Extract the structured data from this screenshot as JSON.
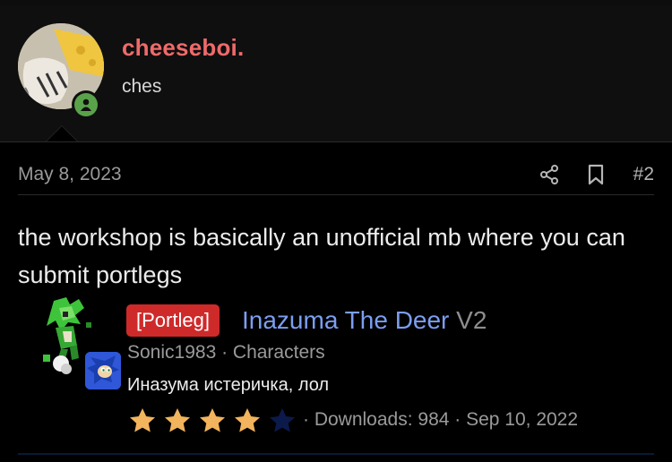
{
  "post": {
    "username": "cheeseboi.",
    "user_title": "ches",
    "date": "May 8, 2023",
    "post_number": "#2",
    "body": "the workshop is basically an unofficial mb where you can submit portlegs"
  },
  "embed": {
    "tag": "[Portleg]",
    "title": "Inazuma The Deer",
    "version": "V2",
    "author_category": "Sonic1983 · Characters",
    "description": "Иназума истеричка, лол",
    "rating_stars": 4,
    "rating_max": 5,
    "downloads_line": "· Downloads: 984 · Sep 10, 2022"
  },
  "colors": {
    "username": "#f06a6a",
    "mod_title": "#7c9ef0",
    "tag_bg": "#cf2a2a",
    "star_filled": "#f2b45c",
    "star_empty": "#0b1a4a",
    "online": "#5aa24a"
  },
  "icons": [
    "share-icon",
    "bookmark-icon",
    "online-status-icon"
  ]
}
